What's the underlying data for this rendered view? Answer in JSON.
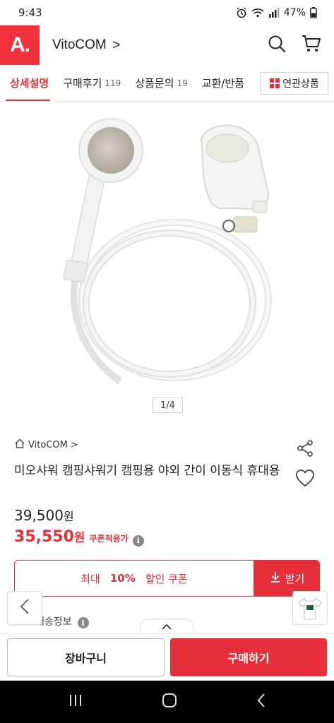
{
  "status": {
    "time": "9:43",
    "battery": "47%"
  },
  "header": {
    "logo": "A.",
    "store_name": "VitoCOM",
    "store_chevron": ">"
  },
  "tabs": [
    {
      "label": "상세설명",
      "count": ""
    },
    {
      "label": "구매후기",
      "count": "119"
    },
    {
      "label": "상품문의",
      "count": "19"
    },
    {
      "label": "교환/반품",
      "count": ""
    }
  ],
  "related_button": "연관상품",
  "image_pager": "1/4",
  "product": {
    "breadcrumb": "VitoCOM",
    "breadcrumb_chevron": ">",
    "title": "미오샤워 캠핑샤워기 캠핑용 야외 간이 이동식 휴대용",
    "original_price": "39,500",
    "sale_price": "35,550",
    "currency": "원",
    "coupon_applied": "쿠폰적용가",
    "info_icon": "i"
  },
  "coupon": {
    "prefix": "최대",
    "percent": "10%",
    "suffix": "할인 쿠폰",
    "receive": "받기"
  },
  "shipping": {
    "label": "배송정보"
  },
  "bottom_bar": {
    "cart": "장바구니",
    "buy": "구매하기"
  },
  "colors": {
    "accent": "#e5303c",
    "logo": "#f0303a"
  },
  "icons": [
    "wifi-icon",
    "signal-icon",
    "battery-icon",
    "alarm-icon",
    "search-icon",
    "cart-icon",
    "share-icon",
    "heart-icon",
    "home-icon",
    "download-icon",
    "truck-icon",
    "chevron-left-icon",
    "chevron-up-icon",
    "recents-icon",
    "home-nav-icon",
    "back-nav-icon"
  ]
}
